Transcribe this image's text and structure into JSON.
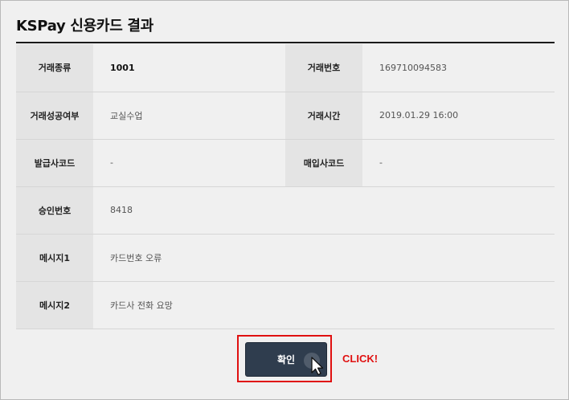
{
  "title": "KSPay 신용카드 결과",
  "rows": [
    {
      "label1": "거래종류",
      "value1": "1001",
      "label2": "거래번호",
      "value2": "169710094583"
    },
    {
      "label1": "거래성공여부",
      "value1": "교실수업",
      "label2": "거래시간",
      "value2": "2019.01.29 16:00"
    },
    {
      "label1": "발급사코드",
      "value1": "-",
      "label2": "매입사코드",
      "value2": "-"
    },
    {
      "label1": "승인번호",
      "value1": "8418"
    },
    {
      "label1": "메시지1",
      "value1": "카드번호 오류"
    },
    {
      "label1": "메시지2",
      "value1": "카드사 전화 요망"
    }
  ],
  "confirm_button": {
    "label": "확인"
  },
  "annotation": {
    "label": "CLICK!",
    "color": "#e01010"
  },
  "icons": {
    "cursor": "mouse-pointer-icon"
  }
}
